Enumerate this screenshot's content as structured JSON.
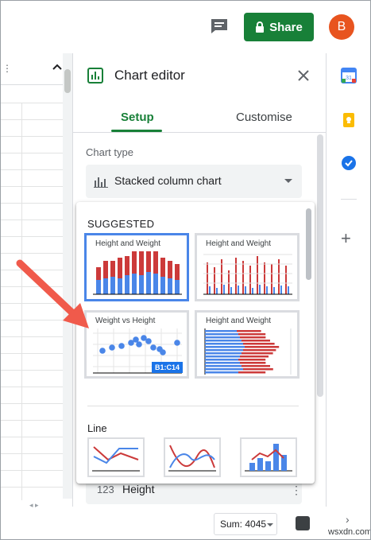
{
  "header": {
    "share_label": "Share",
    "avatar_letter": "B"
  },
  "editor": {
    "title": "Chart editor",
    "tabs": [
      {
        "label": "Setup",
        "active": true
      },
      {
        "label": "Customise",
        "active": false
      }
    ],
    "chart_type_label": "Chart type",
    "chart_type_value": "Stacked column chart",
    "bottom_field_label": "Height"
  },
  "popup": {
    "suggested_label": "SUGGESTED",
    "suggested": [
      {
        "title": "Height and Weight",
        "kind": "stacked-column",
        "selected": true
      },
      {
        "title": "Height and Weight",
        "kind": "column",
        "selected": false
      },
      {
        "title": "Weight vs Height",
        "kind": "scatter",
        "selected": false,
        "badge": "B1:C14"
      },
      {
        "title": "Height and Weight",
        "kind": "stacked-bar",
        "selected": false
      }
    ],
    "line_section_label": "Line",
    "line_charts": [
      "line",
      "smooth-line",
      "combo"
    ]
  },
  "status": {
    "sum_label": "Sum: 4045"
  },
  "sidebar_icons": [
    "calendar-icon",
    "keep-icon",
    "tasks-icon"
  ],
  "watermark": "wsxdn.com",
  "colors": {
    "share_green": "#188038",
    "accent_blue": "#4a86e8",
    "series_red": "#cc3a3a",
    "series_blue": "#4a86e8",
    "avatar": "#e8541f",
    "arrow": "#f05a4b"
  }
}
